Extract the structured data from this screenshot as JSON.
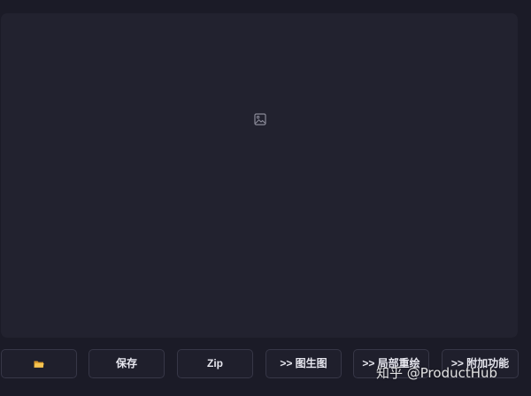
{
  "gallery": {
    "placeholder_icon": "image-icon"
  },
  "toolbar": {
    "open_folder_icon": "folder-icon",
    "save_label": "保存",
    "zip_label": "Zip",
    "send_img2img_label": ">> 图生图",
    "send_inpaint_label": ">> 局部重绘",
    "send_extras_label": ">> 附加功能"
  },
  "watermark": {
    "text": "知乎 @ProductHub"
  },
  "colors": {
    "page_background": "#1b1b27",
    "panel_background": "#22222f",
    "button_border": "#373747",
    "folder_icon": "#f5c451"
  }
}
